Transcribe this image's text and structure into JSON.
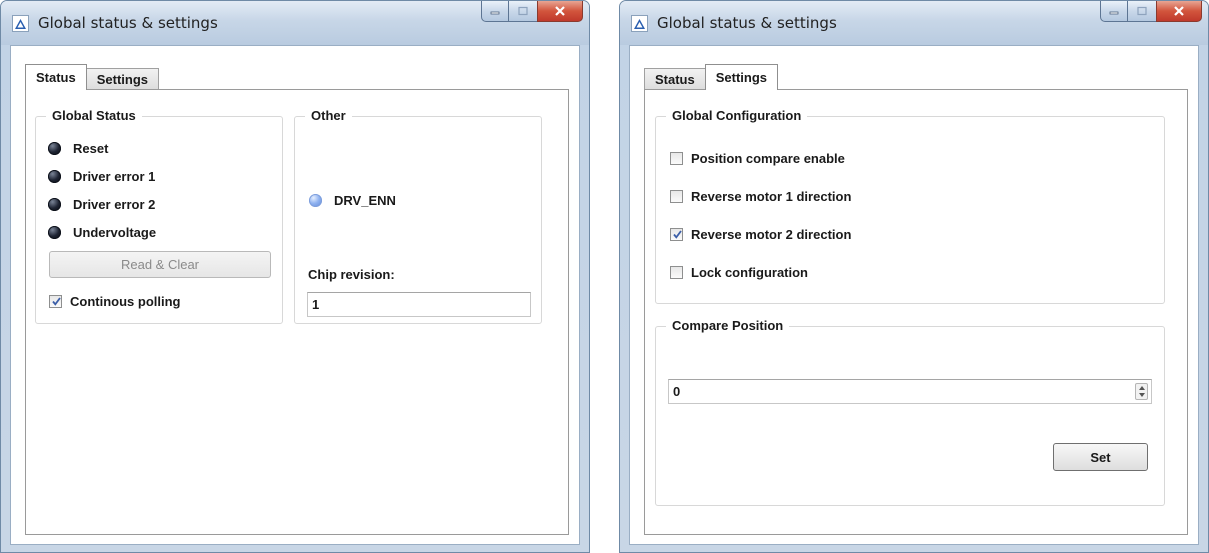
{
  "windows": [
    {
      "title": "Global status & settings",
      "tabs": [
        {
          "label": "Status"
        },
        {
          "label": "Settings"
        }
      ],
      "active_tab": "Status",
      "global_status": {
        "title": "Global Status",
        "indicators": [
          {
            "label": "Reset",
            "color": "#1e2433"
          },
          {
            "label": "Driver error 1",
            "color": "#1e2433"
          },
          {
            "label": "Driver error 2",
            "color": "#1e2433"
          },
          {
            "label": "Undervoltage",
            "color": "#1e2433"
          }
        ],
        "read_clear_label": "Read & Clear",
        "polling_label": "Continous polling",
        "polling_checked": true
      },
      "other": {
        "title": "Other",
        "drv_enn_label": "DRV_ENN",
        "drv_enn_color": "#8fb2f0",
        "chip_revision_label": "Chip revision:",
        "chip_revision_value": "1"
      }
    },
    {
      "title": "Global status & settings",
      "tabs": [
        {
          "label": "Status"
        },
        {
          "label": "Settings"
        }
      ],
      "active_tab": "Settings",
      "global_configuration": {
        "title": "Global Configuration",
        "options": [
          {
            "label": "Position compare enable",
            "checked": false
          },
          {
            "label": "Reverse motor 1 direction",
            "checked": false
          },
          {
            "label": "Reverse motor 2 direction",
            "checked": true
          },
          {
            "label": "Lock configuration",
            "checked": false
          }
        ]
      },
      "compare_position": {
        "title": "Compare Position",
        "value": "0",
        "set_label": "Set"
      }
    }
  ]
}
